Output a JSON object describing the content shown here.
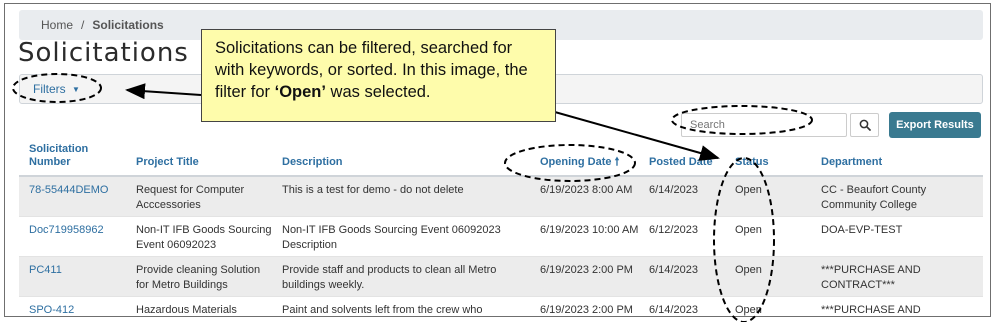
{
  "breadcrumb": {
    "home": "Home",
    "separator": "/",
    "current": "Solicitations"
  },
  "page": {
    "title": "Solicitations"
  },
  "filters": {
    "label": "Filters",
    "caret": "▼"
  },
  "search": {
    "placeholder": "Search",
    "icon": "search-icon"
  },
  "toolbar": {
    "export_label": "Export Results"
  },
  "table": {
    "headers": {
      "number_line1": "Solicitation",
      "number_line2": "Number",
      "title": "Project Title",
      "description": "Description",
      "opening_date": "Opening Date",
      "sort_arrow": "🠕",
      "posted_date": "Posted Date",
      "status": "Status",
      "department": "Department"
    },
    "rows": [
      {
        "number": "78-55444DEMO",
        "title": "Request for Computer Acccessories",
        "description": "This is a test for demo - do not delete",
        "opening": "6/19/2023 8:00 AM",
        "posted": "6/14/2023",
        "status": "Open",
        "department": "CC - Beaufort County Community College"
      },
      {
        "number": "Doc719958962",
        "title": "Non-IT IFB Goods Sourcing Event 06092023",
        "description": "Non-IT IFB Goods Sourcing Event 06092023 Description",
        "opening": "6/19/2023 10:00 AM",
        "posted": "6/12/2023",
        "status": "Open",
        "department": "DOA-EVP-TEST"
      },
      {
        "number": "PC411",
        "title": "Provide cleaning Solution for Metro Buildings",
        "description": "Provide staff and products to clean all Metro buildings weekly.",
        "opening": "6/19/2023 2:00 PM",
        "posted": "6/14/2023",
        "status": "Open",
        "department": "***PURCHASE AND CONTRACT***"
      },
      {
        "number": "SPO-412",
        "title": "Hazardous Materials",
        "description": "Paint and solvents left from the crew who",
        "opening": "6/19/2023 2:00 PM",
        "posted": "6/14/2023",
        "status": "Open",
        "department": "***PURCHASE AND"
      }
    ]
  },
  "callout": {
    "text_before": "Solicitations can be filtered, searched for with keywords, or sorted. In this image, the filter for ",
    "emphasis": "‘Open’",
    "text_after": " was selected."
  },
  "colors": {
    "link": "#2e6fa1",
    "export_button": "#3a7a90",
    "callout_bg": "#fefcab",
    "stripe": "#ececec"
  }
}
